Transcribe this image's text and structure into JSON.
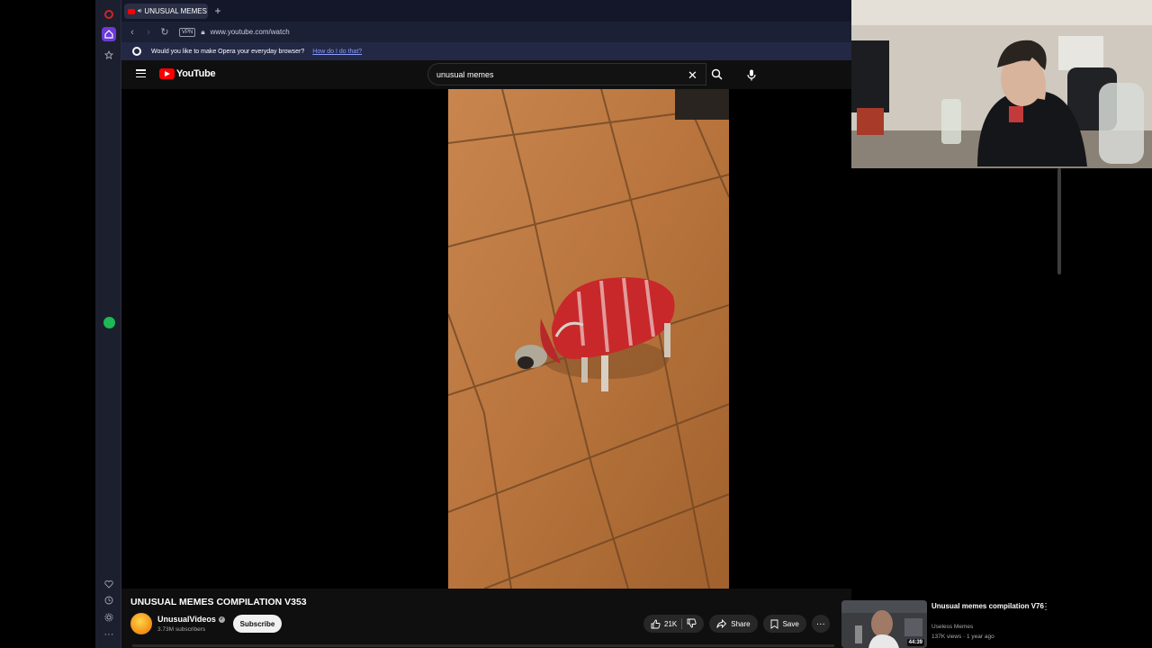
{
  "browser": {
    "tab_title": "UNUSUAL MEMES CO",
    "url": "www.youtube.com/watch",
    "vpn_label": "VPN",
    "notification": {
      "text": "Would you like to make Opera your everyday browser?",
      "link": "How do I do that?"
    }
  },
  "youtube": {
    "logo_text": "YouTube",
    "search": {
      "value": "unusual memes"
    }
  },
  "video": {
    "title": "UNUSUAL MEMES COMPILATION V353",
    "channel": "UnusualVideos",
    "subscribers": "3.73M subscribers",
    "subscribe_label": "Subscribe",
    "likes": "21K",
    "share_label": "Share",
    "save_label": "Save"
  },
  "recommended": [
    {
      "title": "Unusual memes compilation V76",
      "channel": "Useless Memes",
      "meta": "137K views · 1 year ago",
      "duration": "44:39"
    }
  ],
  "icons": {
    "sidebar": [
      "opera-logo-icon",
      "home-icon",
      "star-icon",
      "spotify-icon",
      "heart-icon",
      "history-icon",
      "settings-icon",
      "more-icon"
    ],
    "colors": {
      "youtube_red": "#ff0000",
      "opera_purple": "#6b3bd6",
      "spotify_green": "#1db954"
    }
  }
}
